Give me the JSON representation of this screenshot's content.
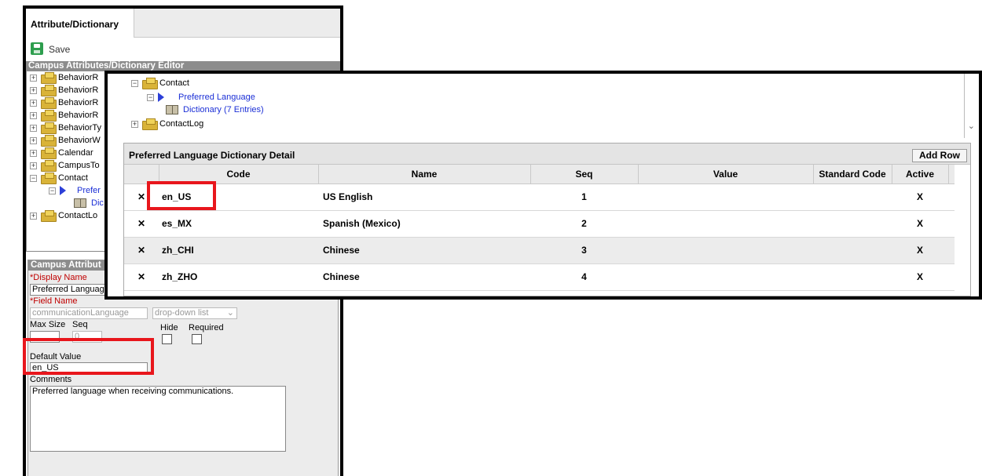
{
  "back_window": {
    "tab_label": "Attribute/Dictionary",
    "save_label": "Save",
    "tree_header": "Campus Attributes/Dictionary Editor",
    "tree_items": [
      {
        "label": "BehaviorR"
      },
      {
        "label": "BehaviorR"
      },
      {
        "label": "BehaviorR"
      },
      {
        "label": "BehaviorR"
      },
      {
        "label": "BehaviorTy"
      },
      {
        "label": "BehaviorW"
      },
      {
        "label": "Calendar"
      },
      {
        "label": "CampusTo"
      },
      {
        "label": "Contact"
      },
      {
        "label": "Prefer"
      },
      {
        "label": "Dic"
      },
      {
        "label": "ContactLo"
      }
    ],
    "detail_header": "Campus Attribut",
    "display_name_label": "*Display Name",
    "display_name_value": "Preferred Languag",
    "field_name_label": "*Field Name",
    "field_name_value": "communicationLanguage",
    "field_type_value": "drop-down list",
    "max_size_label": "Max Size",
    "seq_label": "Seq",
    "seq_value": "0",
    "hide_label": "Hide",
    "required_label": "Required",
    "default_value_label": "Default Value",
    "default_value": "en_US",
    "comments_label": "Comments",
    "comments_value": "Preferred language when receiving communications."
  },
  "front_window": {
    "tree_items": {
      "contact": "Contact",
      "preferred_language": "Preferred Language",
      "dictionary": "Dictionary (7 Entries)",
      "contact_log": "ContactLog"
    },
    "grid_title": "Preferred Language Dictionary Detail",
    "add_row_label": "Add Row",
    "columns": [
      "Code",
      "Name",
      "Seq",
      "Value",
      "Standard Code",
      "Active"
    ],
    "rows": [
      {
        "code": "en_US",
        "name": "US English",
        "seq": "1",
        "value": "",
        "standard_code": "",
        "active": "X"
      },
      {
        "code": "es_MX",
        "name": "Spanish (Mexico)",
        "seq": "2",
        "value": "",
        "standard_code": "",
        "active": "X"
      },
      {
        "code": "zh_CHI",
        "name": "Chinese",
        "seq": "3",
        "value": "",
        "standard_code": "",
        "active": "X"
      },
      {
        "code": "zh_ZHO",
        "name": "Chinese",
        "seq": "4",
        "value": "",
        "standard_code": "",
        "active": "X"
      }
    ],
    "delete_glyph": "✕"
  }
}
